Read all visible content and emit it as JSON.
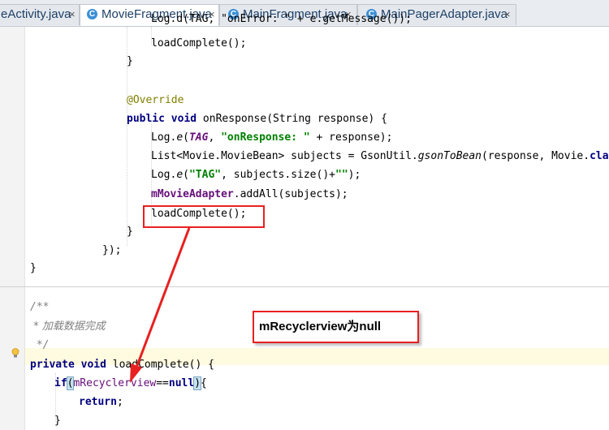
{
  "tabs": [
    {
      "label": "eActivity.java",
      "close": "×"
    },
    {
      "label": "MovieFragment.java",
      "close": "×",
      "icon": "C"
    },
    {
      "label": "MainFragment.java",
      "close": "×",
      "icon": "C"
    },
    {
      "label": "MainPagerAdapter.java",
      "close": "×",
      "icon": "C"
    }
  ],
  "code": {
    "l0": {
      "a": "Log.d(TAG, \"onError: \" + e.getMessage());"
    },
    "l1": {
      "a": "loadComplete();"
    },
    "l2": {
      "a": "}"
    },
    "l3": {
      "a": "@Override"
    },
    "l4": {
      "a": "public",
      "b": " ",
      "c": "void",
      "d": " onResponse(String response) {"
    },
    "l5": {
      "a": "Log.",
      "b": "e",
      "c": "(",
      "d": "TAG",
      "e": ", ",
      "f": "\"onResponse: \"",
      "g": " + response);"
    },
    "l6": {
      "a": "List<Movie.MovieBean> subjects = GsonUtil.",
      "b": "gsonToBean",
      "c": "(response, Movie.",
      "d": "class",
      "e": ");"
    },
    "l7": {
      "a": "Log.",
      "b": "e",
      "c": "(",
      "d": "\"TAG\"",
      "e": ", subjects.size()+",
      "f": "\"\"",
      "g": ");"
    },
    "l8": {
      "a": "mMovieAdapter",
      "b": ".addAll(subjects);"
    },
    "l9": {
      "a": "loadComplete();"
    },
    "l10": {
      "a": "}"
    },
    "l11": {
      "a": "});"
    },
    "l12": {
      "a": "}"
    },
    "l13": {
      "a": "/**"
    },
    "l14": {
      "a": " * 加载数据完成"
    },
    "l15": {
      "a": " */"
    },
    "l16": {
      "a": "private",
      "b": " ",
      "c": "void",
      "d": " loadComplete() {"
    },
    "l17": {
      "a": "if",
      "b": "(",
      "c": "mRecyclerview",
      "d": "==",
      "e": "null",
      "f": ")",
      "g": "{"
    },
    "l18": {
      "a": "return",
      "b": ";"
    },
    "l19": {
      "a": "}"
    }
  },
  "callout": {
    "text": "mRecyclerview为null"
  },
  "colors": {
    "annotation_red": "#e82020",
    "keyword": "#000080",
    "string": "#008000",
    "field": "#660e7a"
  }
}
